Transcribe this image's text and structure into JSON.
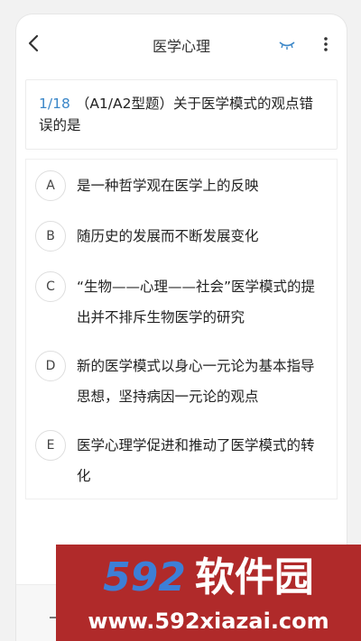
{
  "header": {
    "title": "医学心理"
  },
  "question": {
    "number": "1/18",
    "text": "（A1/A2型题）关于医学模式的观点错误的是"
  },
  "options": [
    {
      "letter": "A",
      "text": "是一种哲学观在医学上的反映"
    },
    {
      "letter": "B",
      "text": "随历史的发展而不断发展变化"
    },
    {
      "letter": "C",
      "text": "“生物——心理——社会”医学模式的提出并不排斥生物医学的研究"
    },
    {
      "letter": "D",
      "text": "新的医学模式以身心一元论为基本指导思想，坚持病因一元论的观点"
    },
    {
      "letter": "E",
      "text": "医学心理学促进和推动了医学模式的转化"
    }
  ],
  "watermark": {
    "number": "592",
    "name": "软件园",
    "url": "www.592xiazai.com"
  },
  "colors": {
    "accent": "#3a86c8",
    "watermark_bg": "#b02a2a",
    "watermark_number": "#3d7fd6"
  }
}
